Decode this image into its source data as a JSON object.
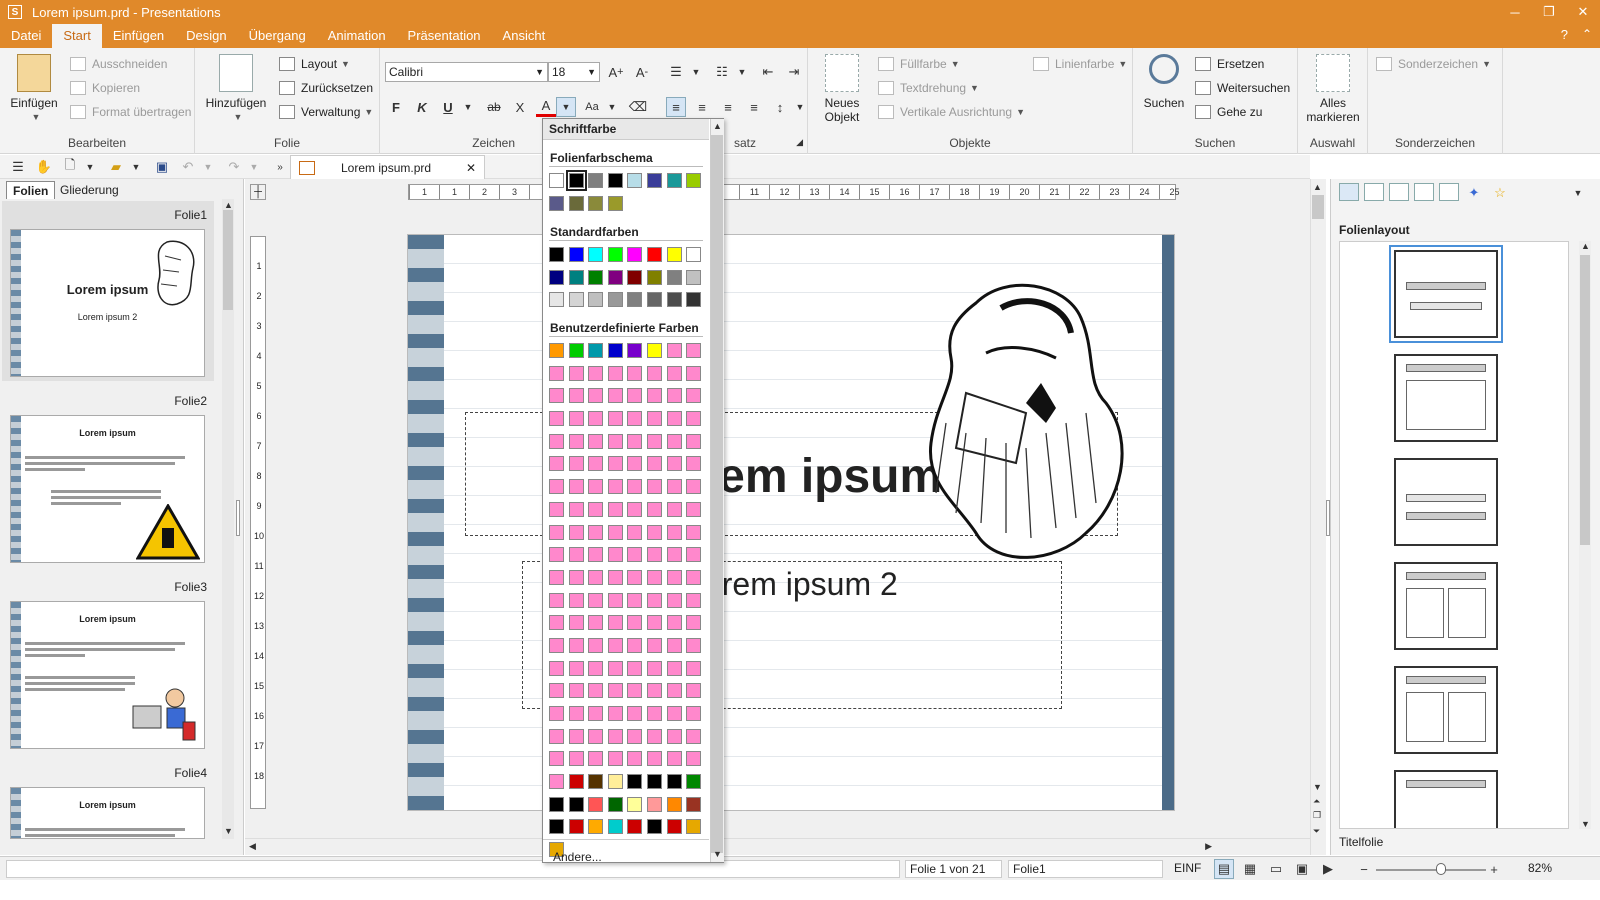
{
  "window": {
    "title": "Lorem ipsum.prd - Presentations",
    "app_letter": "S",
    "minimize": "─",
    "restore": "❐",
    "close": "✕"
  },
  "menu": {
    "items": [
      "Datei",
      "Start",
      "Einfügen",
      "Design",
      "Übergang",
      "Animation",
      "Präsentation",
      "Ansicht"
    ],
    "help": "?",
    "collapse": "⌃"
  },
  "ribbon": {
    "bearbeiten": {
      "label": "Bearbeiten",
      "paste": "Einfügen",
      "cut": "Ausschneiden",
      "copy": "Kopieren",
      "format": "Format übertragen"
    },
    "folie": {
      "label": "Folie",
      "add": "Hinzufügen",
      "layout": "Layout",
      "reset": "Zurücksetzen",
      "admin": "Verwaltung"
    },
    "zeichen": {
      "label": "Zeichen",
      "font": "Calibri",
      "size": "18",
      "bold": "F",
      "italic": "K",
      "underline": "U",
      "strike": "ab",
      "x": "X",
      "color": "A"
    },
    "absatz": {
      "label": "satz"
    },
    "objekte": {
      "label": "Objekte",
      "new_object": "Neues Objekt",
      "fill": "Füllfarbe",
      "rotate": "Textdrehung",
      "valign": "Vertikale Ausrichtung",
      "line": "Linienfarbe"
    },
    "suchen": {
      "label": "Suchen",
      "search": "Suchen",
      "replace": "Ersetzen",
      "findnext": "Weitersuchen",
      "goto": "Gehe zu"
    },
    "auswahl": {
      "label": "Auswahl",
      "select_all": "Alles markieren"
    },
    "sonder": {
      "label": "Sonderzeichen",
      "special": "Sonderzeichen"
    }
  },
  "doc_tab": {
    "name": "Lorem ipsum.prd",
    "close": "✕"
  },
  "left_panel": {
    "tabs": [
      "Folien",
      "Gliederung"
    ],
    "slides": [
      {
        "label": "Folie1",
        "title": "Lorem ipsum",
        "subtitle": "Lorem ipsum 2"
      },
      {
        "label": "Folie2",
        "title": "Lorem ipsum"
      },
      {
        "label": "Folie3",
        "title": "Lorem ipsum"
      },
      {
        "label": "Folie4",
        "title": "Lorem ipsum"
      }
    ]
  },
  "slide": {
    "title": "Lorem ipsum",
    "subtitle": "Lorem ipsum 2"
  },
  "hruler_labels": [
    "1",
    "1",
    "2",
    "3",
    "4",
    "5",
    "",
    "",
    "",
    "",
    "",
    "11",
    "12",
    "13",
    "14",
    "15",
    "16",
    "17",
    "18",
    "19",
    "20",
    "21",
    "22",
    "23",
    "24",
    "25"
  ],
  "vruler_labels": [
    "1",
    "2",
    "3",
    "4",
    "5",
    "6",
    "7",
    "8",
    "9",
    "10",
    "11",
    "12",
    "13",
    "14",
    "15",
    "16",
    "17",
    "18"
  ],
  "color_popup": {
    "title": "Schriftfarbe",
    "scheme_label": "Folienfarbschema",
    "scheme": [
      "#ffffff",
      "#000000",
      "#7f7f7f",
      "#000000",
      "#b7dde8",
      "#3a3d99",
      "#1a9999",
      "#99cc00",
      "#5a5a8a",
      "#6a6a3a",
      "#8a8a3a",
      "#9a9a2a"
    ],
    "standard_label": "Standardfarben",
    "standard": [
      "#000000",
      "#0000ff",
      "#00ffff",
      "#00ff00",
      "#ff00ff",
      "#ff0000",
      "#ffff00",
      "#ffffff",
      "#000080",
      "#008080",
      "#008000",
      "#800080",
      "#800000",
      "#808000",
      "#808080",
      "#c0c0c0",
      "#e6e6e6",
      "#d4d4d4",
      "#bfbfbf",
      "#999999",
      "#808080",
      "#666666",
      "#4d4d4d",
      "#333333"
    ],
    "custom_label": "Benutzerdefinierte Farben",
    "custom_top": [
      "#ff9900",
      "#00cc00",
      "#0099aa",
      "#0000cc",
      "#7700cc",
      "#ffff00",
      "#ff88cc",
      "#ff88cc"
    ],
    "custom_pink": "#ff88cc",
    "custom_pink_count": 144,
    "custom_bottom": [
      "#ff88cc",
      "#cc0000",
      "#553300",
      "#ffee99",
      "#000000",
      "#000000",
      "#000000",
      "#008800",
      "#000000",
      "#000000",
      "#ff5555",
      "#006600",
      "#ffff99",
      "#ff9999",
      "#ff8800",
      "#993322",
      "#000000",
      "#cc0000",
      "#ffaa00",
      "#00cccc",
      "#cc0000",
      "#000000",
      "#cc0000",
      "#e6a800",
      "#e6a800"
    ],
    "more": "Andere..."
  },
  "right_panel": {
    "title": "Folienlayout",
    "caption": "Titelfolie"
  },
  "status": {
    "position": "Folie 1 von 21",
    "slide_name": "Folie1",
    "mode": "EINF",
    "zoom": "82%",
    "minus": "−",
    "plus": "+"
  }
}
